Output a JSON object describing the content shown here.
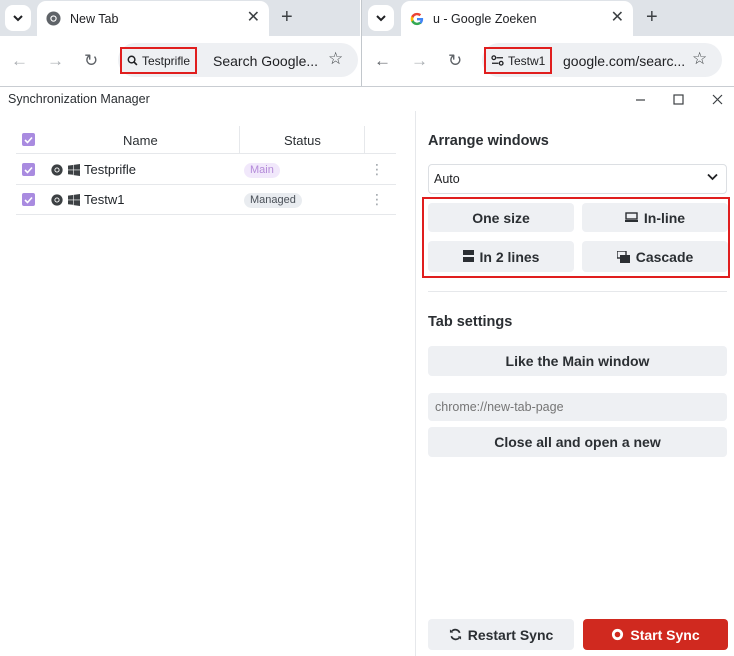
{
  "browser_left": {
    "tab_title": "New Tab",
    "profile_chip": "Testprifle",
    "omnibox_text": "Search Google..."
  },
  "browser_right": {
    "tab_title": "u - Google Zoeken",
    "profile_chip": "Testw1",
    "omnibox_text": "google.com/searc..."
  },
  "window": {
    "title": "Synchronization Manager"
  },
  "table": {
    "headers": {
      "name": "Name",
      "status": "Status"
    },
    "rows": [
      {
        "name": "Testprifle",
        "status": "Main",
        "checked": true
      },
      {
        "name": "Testw1",
        "status": "Managed",
        "checked": true
      }
    ]
  },
  "arrange": {
    "heading": "Arrange windows",
    "mode": "Auto",
    "buttons": {
      "one_size": "One size",
      "inline": "In-line",
      "two_lines": "In 2 lines",
      "cascade": "Cascade"
    }
  },
  "tabs": {
    "heading": "Tab settings",
    "like_main": "Like the Main window",
    "url_placeholder": "chrome://new-tab-page",
    "close_all": "Close all and open a new"
  },
  "footer": {
    "restart": "Restart Sync",
    "start": "Start Sync"
  },
  "colors": {
    "accent": "#a98be0",
    "danger": "#d0291f",
    "highlight": "#e01e1e"
  }
}
